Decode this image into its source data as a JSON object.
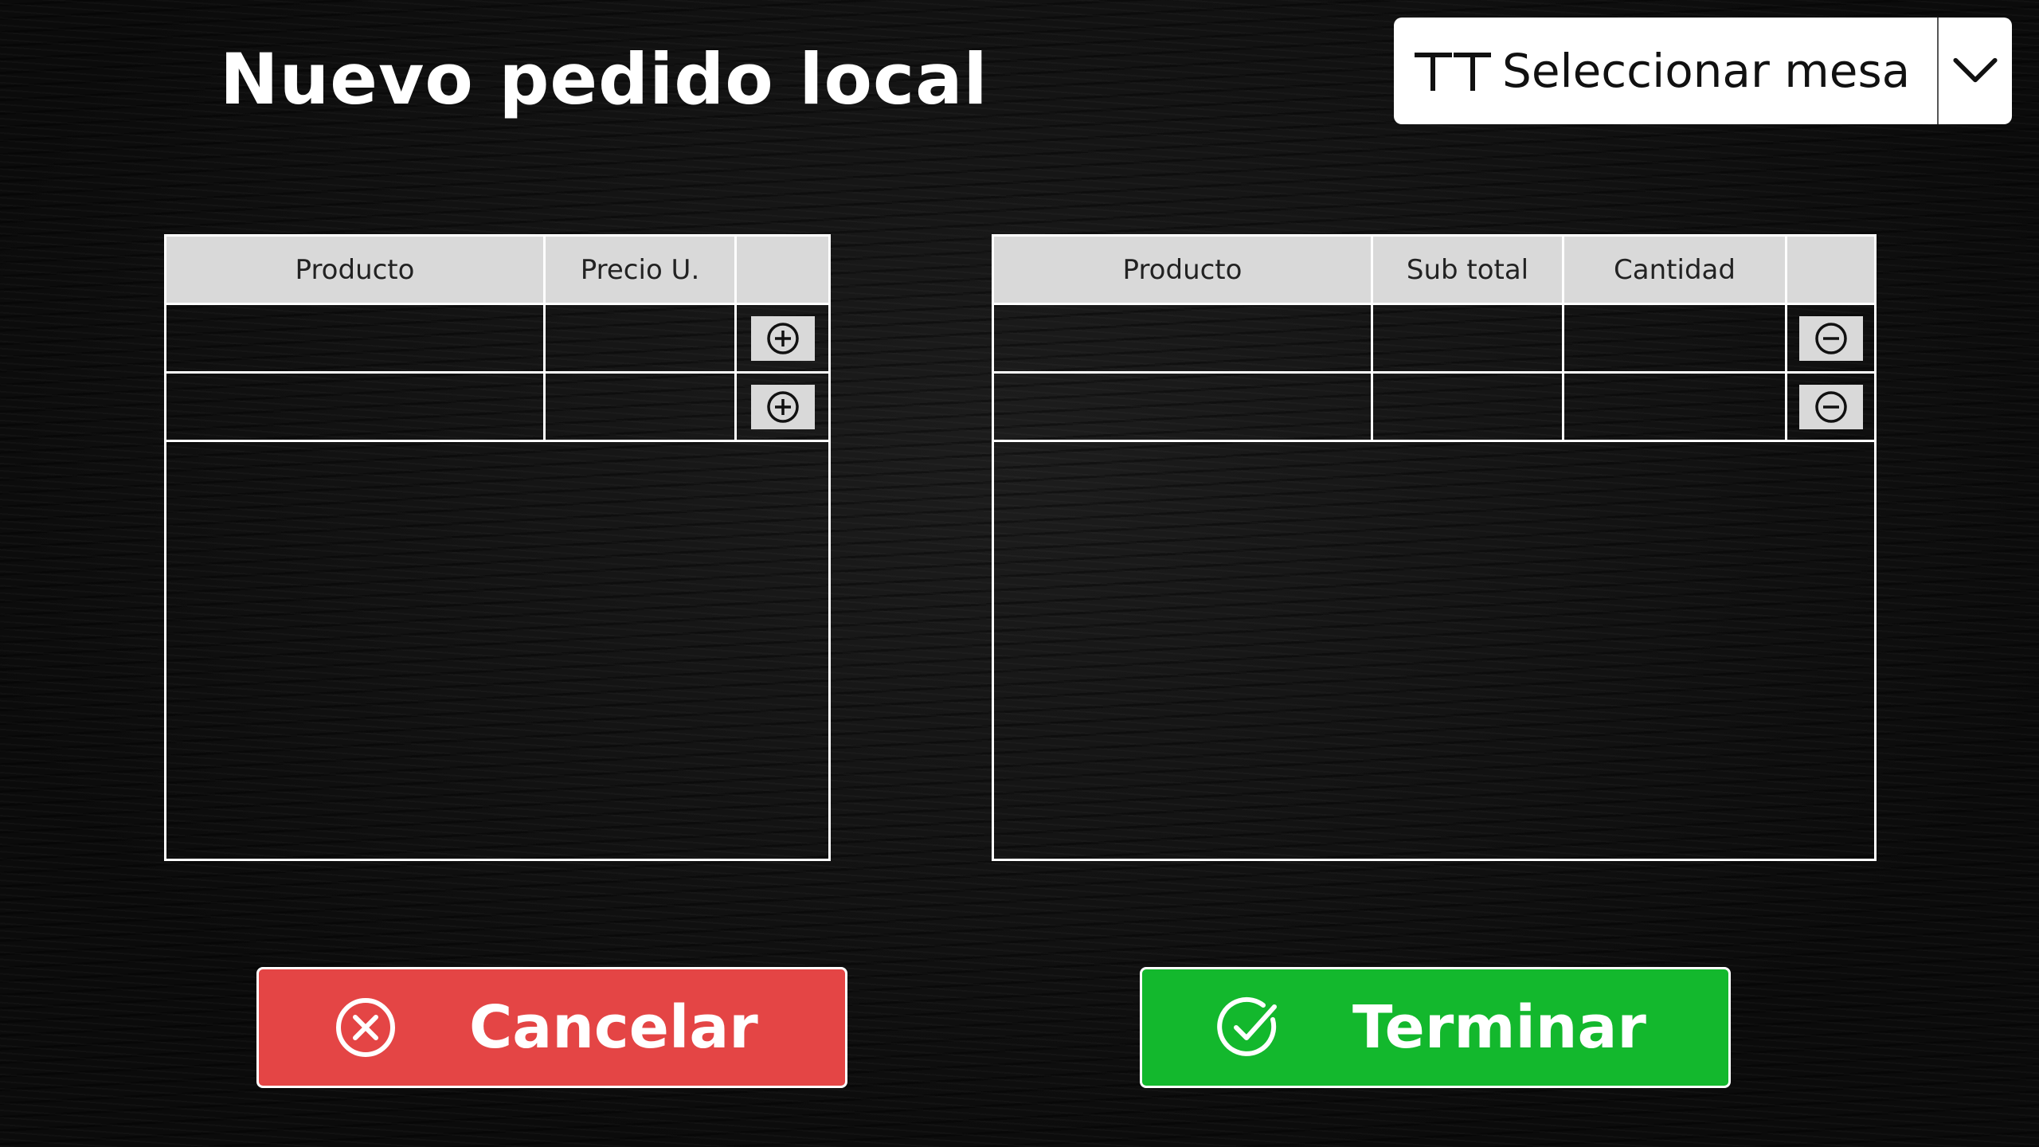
{
  "header": {
    "title": "Nuevo pedido local"
  },
  "table_select": {
    "placeholder": "Seleccionar mesa",
    "icon": "text-icon",
    "dropdown_icon": "chevron-down-icon"
  },
  "products_table": {
    "columns": [
      "Producto",
      "Precio U.",
      ""
    ],
    "rows": [
      {
        "producto": "",
        "precio": "",
        "action_icon": "plus-circle-icon"
      },
      {
        "producto": "",
        "precio": "",
        "action_icon": "plus-circle-icon"
      }
    ]
  },
  "order_table": {
    "columns": [
      "Producto",
      "Sub total",
      "Cantidad",
      ""
    ],
    "rows": [
      {
        "producto": "",
        "subtotal": "",
        "cantidad": "",
        "action_icon": "minus-circle-icon"
      },
      {
        "producto": "",
        "subtotal": "",
        "cantidad": "",
        "action_icon": "minus-circle-icon"
      }
    ]
  },
  "actions": {
    "cancel_label": "Cancelar",
    "cancel_icon": "x-circle-icon",
    "cancel_color": "#e44545",
    "finish_label": "Terminar",
    "finish_icon": "check-circle-icon",
    "finish_color": "#13b82d"
  }
}
